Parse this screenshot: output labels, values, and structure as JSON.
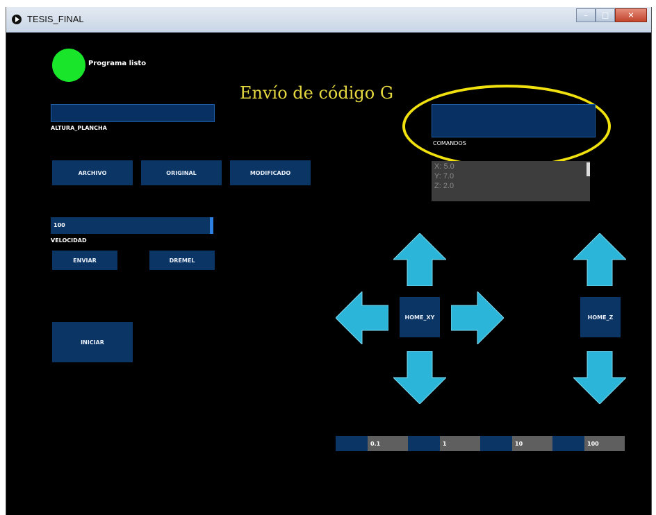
{
  "window": {
    "title": "TESIS_FINAL",
    "controls": [
      "–",
      "□",
      "✕"
    ]
  },
  "status": {
    "label": "Programa listo",
    "color": "#19e62b"
  },
  "header": {
    "title": "Envío de código G"
  },
  "altura": {
    "label": "ALTURA_PLANCHA",
    "value": ""
  },
  "file_buttons": {
    "archivo": "ARCHIVO",
    "original": "ORIGINAL",
    "modificado": "MODIFICADO"
  },
  "velocidad": {
    "value": "100",
    "label": "VELOCIDAD",
    "level_fraction": 1.0
  },
  "action_buttons": {
    "enviar": "ENVIAR",
    "dremel": "DREMEL",
    "iniciar": "INICIAR"
  },
  "comandos": {
    "label": "COMANDOS",
    "value": ""
  },
  "log_lines": [
    "X: 5.0",
    "Y: 7.0",
    "Z: 2.0"
  ],
  "jog": {
    "home_xy": "HOME_XY",
    "home_z": "HOME_Z",
    "arrow_color": "#2bb6d9"
  },
  "step_options": [
    "0.1",
    "1",
    "10",
    "100"
  ],
  "colors": {
    "accent": "#0b3565",
    "highlight": "#f1e10f",
    "background": "#000000"
  }
}
